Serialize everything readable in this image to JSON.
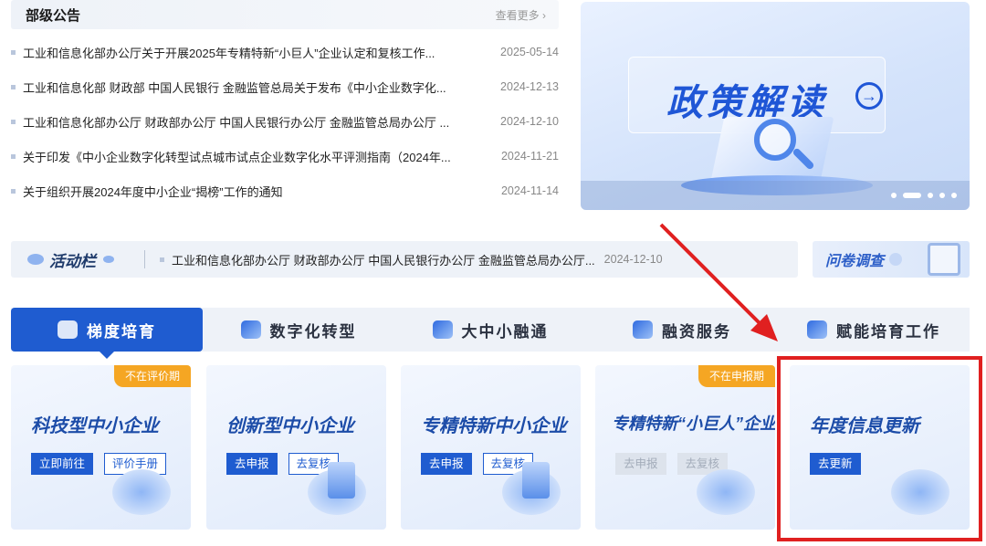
{
  "announcements": {
    "title": "部级公告",
    "more": "查看更多",
    "items": [
      {
        "title": "工业和信息化部办公厅关于开展2025年专精特新“小巨人”企业认定和复核工作...",
        "date": "2025-05-14"
      },
      {
        "title": "工业和信息化部 财政部 中国人民银行 金融监管总局关于发布《中小企业数字化...",
        "date": "2024-12-13"
      },
      {
        "title": "工业和信息化部办公厅 财政部办公厅 中国人民银行办公厅 金融监管总局办公厅 ...",
        "date": "2024-12-10"
      },
      {
        "title": "关于印发《中小企业数字化转型试点城市试点企业数字化水平评测指南（2024年...",
        "date": "2024-11-21"
      },
      {
        "title": "关于组织开展2024年度中小企业“揭榜”工作的通知",
        "date": "2024-11-14"
      }
    ]
  },
  "banner": {
    "title": "政策解读",
    "icon": "arrow-right-circle-icon"
  },
  "activity": {
    "title": "活动栏",
    "text": "工业和信息化部办公厅 财政部办公厅 中国人民银行办公厅 金融监管总局办公厅...",
    "date": "2024-12-10"
  },
  "survey": {
    "label": "问卷调查"
  },
  "tabs": [
    {
      "label": "梯度培育",
      "active": true
    },
    {
      "label": "数字化转型",
      "active": false
    },
    {
      "label": "大中小融通",
      "active": false
    },
    {
      "label": "融资服务",
      "active": false
    },
    {
      "label": "赋能培育工作",
      "active": false
    }
  ],
  "cards": [
    {
      "title": "科技型中小企业",
      "tag": "不在评价期",
      "buttons": [
        "立即前往",
        "评价手册"
      ]
    },
    {
      "title": "创新型中小企业",
      "tag": "",
      "buttons": [
        "去申报",
        "去复核"
      ]
    },
    {
      "title": "专精特新中小企业",
      "tag": "",
      "buttons": [
        "去申报",
        "去复核"
      ]
    },
    {
      "title": "专精特新“小巨人”企业",
      "tag": "不在申报期",
      "buttons": [
        "去申报",
        "去复核"
      ]
    },
    {
      "title": "年度信息更新",
      "tag": "",
      "buttons": [
        "去更新"
      ]
    }
  ],
  "colors": {
    "accent": "#1f5cd0",
    "tag": "#f5a623",
    "highlight": "#e02020"
  }
}
